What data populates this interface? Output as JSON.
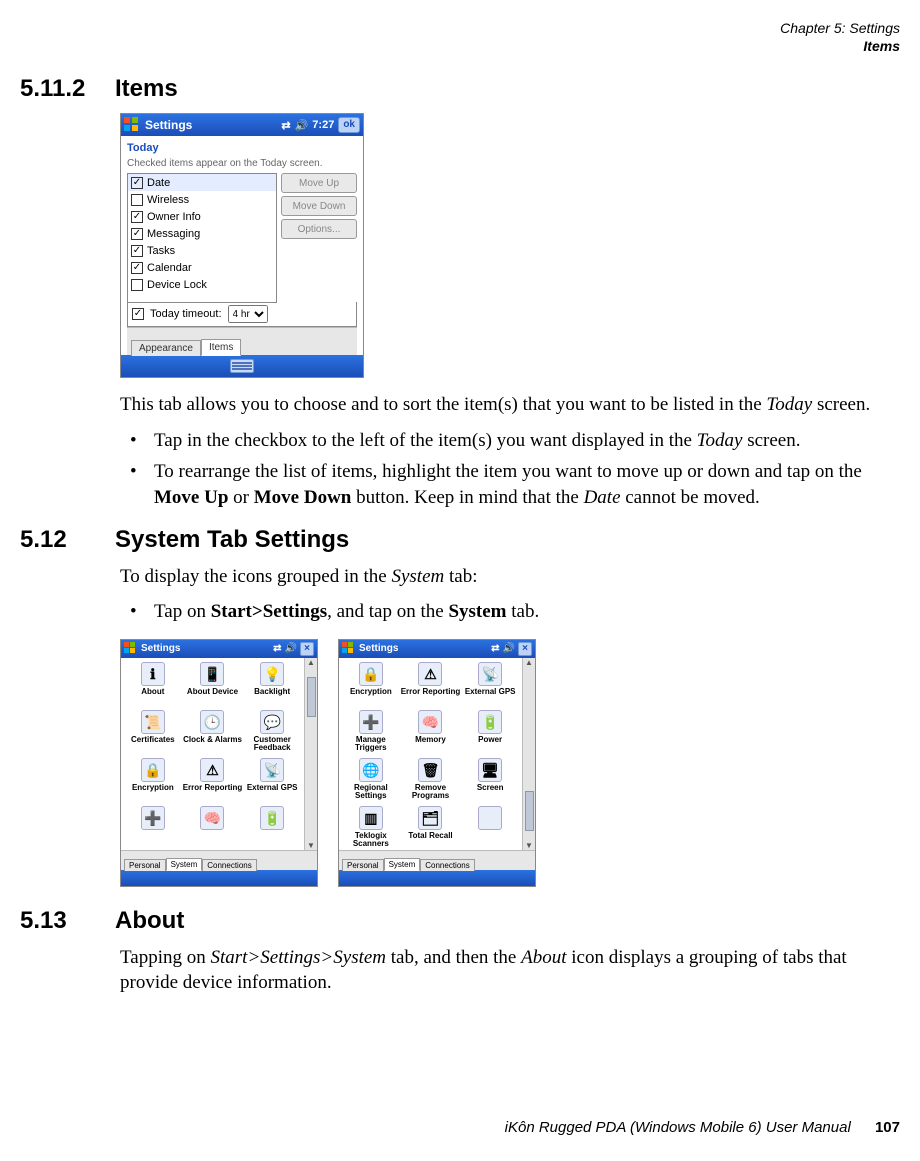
{
  "header": {
    "chapter_line": "Chapter 5:  Settings",
    "section_line": "Items"
  },
  "s5_11_2": {
    "num": "5.11.2",
    "title": "Items",
    "para": "This tab allows you to choose and to sort the item(s) that you want to be listed in the ",
    "para_tail": " screen.",
    "bullet1_a": "Tap in the checkbox to the left of the item(s) you want displayed in the ",
    "bullet1_b": " screen.",
    "bullet2_a": "To rearrange the list of items, highlight the item you want to move up or down and tap on the ",
    "bullet2_b": " or ",
    "bullet2_c": " button. Keep in mind that the ",
    "bullet2_d": " cannot be moved.",
    "emph_today": "Today",
    "strong_moveup": "Move Up",
    "strong_movedown": "Move Down",
    "emph_date": "Date"
  },
  "s5_12": {
    "num": "5.12",
    "title": "System Tab Settings",
    "para_a": "To display the icons grouped in the ",
    "para_b": " tab:",
    "emph_system": "System",
    "bullet_a": "Tap on ",
    "bullet_b": ", and tap on the ",
    "bullet_c": " tab.",
    "strong_path": "Start>Settings",
    "strong_system": "System"
  },
  "s5_13": {
    "num": "5.13",
    "title": "About",
    "para_a": "Tapping on ",
    "para_b": " tab, and then the ",
    "para_c": " icon displays a grouping of tabs that provide device information.",
    "emph_path": "Start>Settings>System",
    "emph_about": "About"
  },
  "footer": {
    "text": "iKôn Rugged PDA (Windows Mobile 6) User Manual",
    "page": "107"
  },
  "pda_items": {
    "title": "Settings",
    "time": "7:27",
    "ok": "ok",
    "subhead": "Today",
    "hint": "Checked items appear on the Today screen.",
    "list": [
      {
        "label": "Date",
        "checked": true,
        "selected": true
      },
      {
        "label": "Wireless",
        "checked": false,
        "selected": false
      },
      {
        "label": "Owner Info",
        "checked": true,
        "selected": false
      },
      {
        "label": "Messaging",
        "checked": true,
        "selected": false
      },
      {
        "label": "Tasks",
        "checked": true,
        "selected": false
      },
      {
        "label": "Calendar",
        "checked": true,
        "selected": false
      },
      {
        "label": "Device Lock",
        "checked": false,
        "selected": false
      }
    ],
    "btn_up": "Move Up",
    "btn_down": "Move Down",
    "btn_options": "Options...",
    "timeout_label": "Today timeout:",
    "timeout_value": "4 hr",
    "tab_appearance": "Appearance",
    "tab_items": "Items"
  },
  "pda_sys": {
    "title": "Settings",
    "tab_personal": "Personal",
    "tab_system": "System",
    "tab_connections": "Connections",
    "screen1": [
      {
        "label": "About",
        "glyph": "ℹ"
      },
      {
        "label": "About Device",
        "glyph": "📱"
      },
      {
        "label": "Backlight",
        "glyph": "💡"
      },
      {
        "label": "Certificates",
        "glyph": "📜"
      },
      {
        "label": "Clock & Alarms",
        "glyph": "🕒"
      },
      {
        "label": "Customer Feedback",
        "glyph": "💬"
      },
      {
        "label": "Encryption",
        "glyph": "🔒"
      },
      {
        "label": "Error Reporting",
        "glyph": "⚠"
      },
      {
        "label": "External GPS",
        "glyph": "📡"
      },
      {
        "label": "",
        "glyph": "➕"
      },
      {
        "label": "",
        "glyph": "🧠"
      },
      {
        "label": "",
        "glyph": "🔋"
      }
    ],
    "screen2": [
      {
        "label": "Encryption",
        "glyph": "🔒"
      },
      {
        "label": "Error Reporting",
        "glyph": "⚠"
      },
      {
        "label": "External GPS",
        "glyph": "📡"
      },
      {
        "label": "Manage Triggers",
        "glyph": "➕"
      },
      {
        "label": "Memory",
        "glyph": "🧠"
      },
      {
        "label": "Power",
        "glyph": "🔋"
      },
      {
        "label": "Regional Settings",
        "glyph": "🌐"
      },
      {
        "label": "Remove Programs",
        "glyph": "🗑"
      },
      {
        "label": "Screen",
        "glyph": "🖥"
      },
      {
        "label": "Teklogix Scanners",
        "glyph": "▥"
      },
      {
        "label": "Total Recall",
        "glyph": "🗂"
      },
      {
        "label": "",
        "glyph": ""
      }
    ]
  }
}
